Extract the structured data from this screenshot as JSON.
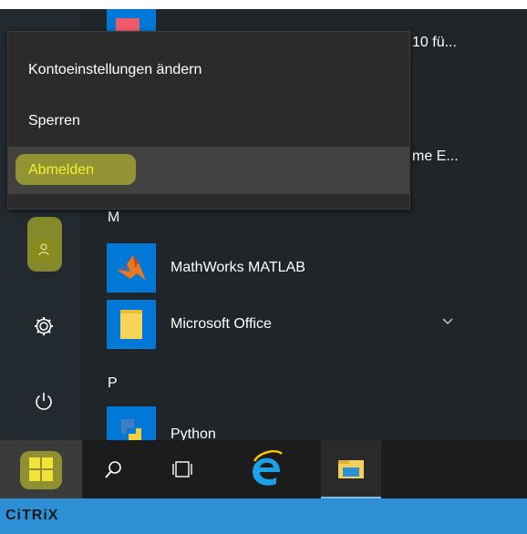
{
  "context_menu": {
    "items": [
      {
        "label": "Kontoeinstellungen ändern"
      },
      {
        "label": "Sperren"
      },
      {
        "label": "Abmelden"
      }
    ],
    "highlight_color": "#d6d928",
    "selected_text_color": "#f0f030"
  },
  "app_list": {
    "partial_label_1": "10 fü...",
    "partial_label_2": "me E...",
    "letter_m": "M",
    "letter_p": "P",
    "items": [
      {
        "label": "MathWorks MATLAB",
        "icon": "matlab-icon"
      },
      {
        "label": "Microsoft Office",
        "icon": "folder-icon"
      },
      {
        "label": "Python",
        "icon": "python-icon"
      }
    ]
  },
  "left_rail": {
    "icons": [
      "user-avatar-icon",
      "gear-icon",
      "power-icon"
    ]
  },
  "taskbar": {
    "icons": [
      "windows-start-icon",
      "search-icon",
      "task-view-icon",
      "internet-explorer-icon",
      "file-explorer-icon"
    ]
  },
  "citrix": {
    "brand": "CiTRiX",
    "bar_color": "#2d8fd4"
  },
  "colors": {
    "start_bg": "#1f2529",
    "rail_bg": "#232a2f",
    "taskbar_bg": "#1c1c1c",
    "tile_blue": "#0078d7"
  }
}
